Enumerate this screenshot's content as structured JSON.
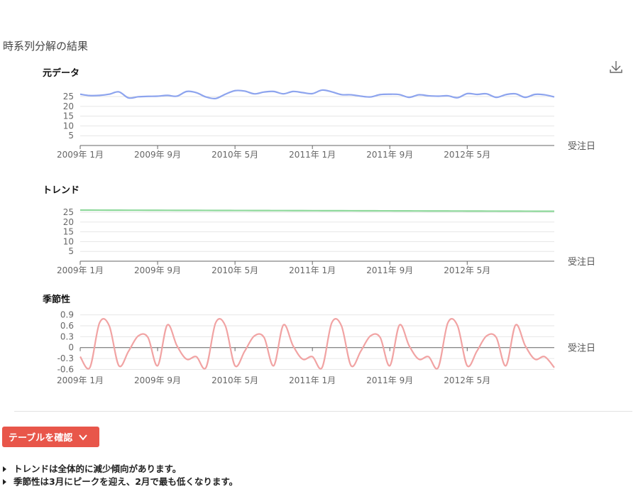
{
  "section_title": "時系列分解の結果",
  "download_icon": "download-icon",
  "colors": {
    "original": "#8da4ee",
    "trend": "#8fd99c",
    "seasonal": "#f1a3a3",
    "button": "#e8564a"
  },
  "chart_data": [
    {
      "type": "line",
      "title": "元データ",
      "xlabel": "受注日",
      "x_tick_labels": [
        "2009年 1月",
        "2009年 9月",
        "2010年 5月",
        "2011年 1月",
        "2011年 9月",
        "2012年 5月"
      ],
      "y_ticks": [
        5,
        10,
        15,
        20,
        25
      ],
      "ylim": [
        0,
        29
      ],
      "x_start": "2009-01",
      "values": [
        26.2,
        25.5,
        25.6,
        26.2,
        27.4,
        24.3,
        24.9,
        25.1,
        25.2,
        25.6,
        25.2,
        27.6,
        27.0,
        24.8,
        24.0,
        26.2,
        28.0,
        27.8,
        26.4,
        27.3,
        27.6,
        26.4,
        27.6,
        27.0,
        26.5,
        28.3,
        27.4,
        26.0,
        25.9,
        25.2,
        24.8,
        26.0,
        26.2,
        26.0,
        24.6,
        25.9,
        25.4,
        25.2,
        25.4,
        24.4,
        26.5,
        26.1,
        26.4,
        24.6,
        26.0,
        26.4,
        24.6,
        26.1,
        25.9,
        24.8
      ],
      "grid": true
    },
    {
      "type": "line",
      "title": "トレンド",
      "xlabel": "受注日",
      "x_tick_labels": [
        "2009年 1月",
        "2009年 9月",
        "2010年 5月",
        "2011年 1月",
        "2011年 9月",
        "2012年 5月"
      ],
      "y_ticks": [
        5,
        10,
        15,
        20,
        25
      ],
      "ylim": [
        0,
        29
      ],
      "values": [
        26.1,
        25.5
      ],
      "grid": true
    },
    {
      "type": "line",
      "title": "季節性",
      "xlabel": "受注日",
      "x_tick_labels": [
        "2009年 1月",
        "2009年 9月",
        "2010年 5月",
        "2011年 1月",
        "2011年 9月",
        "2012年 5月"
      ],
      "y_ticks": [
        -0.6,
        -0.3,
        0,
        0.3,
        0.6,
        0.9
      ],
      "ylim": [
        -0.65,
        0.95
      ],
      "pattern": [
        -0.25,
        -0.55,
        0.68,
        0.6,
        -0.5,
        -0.1,
        0.32,
        0.28,
        -0.5,
        0.62,
        0.05,
        -0.32
      ],
      "grid": true
    }
  ],
  "table_button": {
    "label": "テーブルを確認",
    "icon": "chevron-down-icon"
  },
  "notes": [
    "トレンドは全体的に減少傾向があります。",
    "季節性は3月にピークを迎え、2月で最も低くなります。"
  ]
}
